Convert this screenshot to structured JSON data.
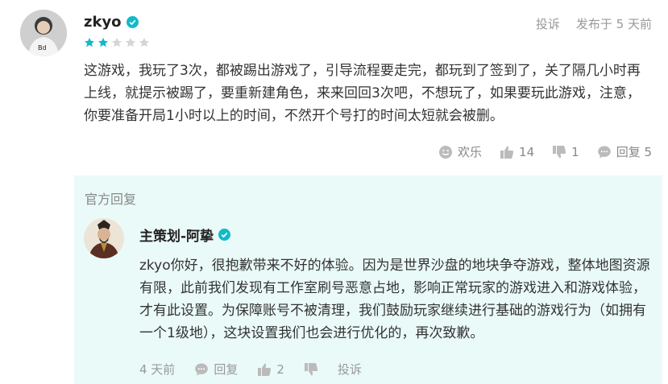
{
  "review": {
    "username": "zkyo",
    "rating": 2,
    "rating_max": 5,
    "report_label": "投诉",
    "posted_label": "发布于 5 天前",
    "text": "这游戏，我玩了3次，都被踢出游戏了，引导流程要走完，都玩到了签到了，关了隔几小时再上线，就提示被踢了，要重新建角色，来来回回3次吧，不想玩了，如果要玩此游戏，注意，你要准备开局1小时以上的时间，不然开个号打的时间太短就会被删。",
    "actions": {
      "funny_label": "欢乐",
      "like_count": "14",
      "dislike_count": "1",
      "reply_label": "回复 5"
    }
  },
  "official_reply": {
    "section_title": "官方回复",
    "author": "主策划-阿挚",
    "text": "zkyo你好，很抱歉带来不好的体验。因为是世界沙盘的地块争夺游戏，整体地图资源有限，此前我们发现有工作室刷号恶意占地，影响正常玩家的游戏进入和游戏体验，才有此设置。为保障账号不被清理，我们鼓励玩家继续进行基础的游戏行为（如拥有一个1级地），这块设置我们也会进行优化的，再次致歉。",
    "time_label": "4 天前",
    "reply_label": "回复",
    "like_count": "2",
    "report_label": "投诉"
  },
  "colors": {
    "verified": "#14b9c8",
    "star_on": "#14b9c8",
    "star_off": "#d5d5d5",
    "reply_bg": "#eafaf8"
  }
}
